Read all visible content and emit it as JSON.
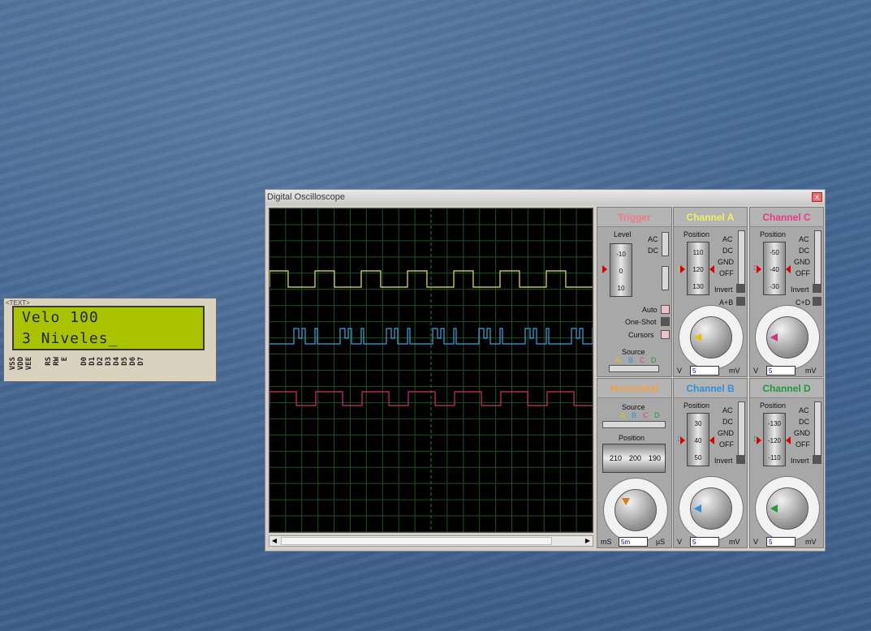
{
  "lcd": {
    "tag": "<TEXT>",
    "line1": "Velo 100",
    "line2": "3 Niveles_",
    "pins": [
      "VSS",
      "VDD",
      "VEE",
      "RS",
      "RW",
      "E",
      "D0",
      "D1",
      "D2",
      "D3",
      "D4",
      "D5",
      "D6",
      "D7"
    ]
  },
  "scope": {
    "title": "Digital Oscilloscope",
    "close_label": "x",
    "traces": [
      {
        "name": "A",
        "color": "#e8e56a"
      },
      {
        "name": "B",
        "color": "#35a8e0"
      },
      {
        "name": "C",
        "color": "#d0306a"
      }
    ]
  },
  "trigger": {
    "title": "Trigger",
    "level_label": "Level",
    "drum": [
      "-10",
      "0",
      "10"
    ],
    "ac": "AC",
    "dc": "DC",
    "auto": "Auto",
    "one_shot": "One-Shot",
    "cursors": "Cursors",
    "source_label": "Source",
    "sources": [
      "A",
      "B",
      "C",
      "D"
    ],
    "title_color": "#f07a8a"
  },
  "horizontal": {
    "title": "Horizontal",
    "source_label": "Source",
    "sources": [
      "A",
      "B",
      "C",
      "D"
    ],
    "position_label": "Position",
    "position_values": [
      "210",
      "200",
      "190"
    ],
    "unit_left": "mS",
    "value": "5m",
    "unit_right": "µS",
    "scale": [
      "0.5",
      "0.2",
      "1",
      "2",
      "5",
      "10",
      "20",
      "50",
      "100",
      "200",
      "0.1",
      "50",
      "20",
      "10"
    ],
    "title_color": "#f0a040"
  },
  "channel_a": {
    "title": "Channel A",
    "position_label": "Position",
    "drum": [
      "110",
      "120",
      "130"
    ],
    "modes": [
      "AC",
      "DC",
      "GND",
      "OFF"
    ],
    "invert": "Invert",
    "extra": "A+B",
    "unit_left": "V",
    "value": "5",
    "unit_right": "mV",
    "title_color": "#f0f060"
  },
  "channel_b": {
    "title": "Channel B",
    "position_label": "Position",
    "drum": [
      "30",
      "40",
      "50"
    ],
    "modes": [
      "AC",
      "DC",
      "GND",
      "OFF"
    ],
    "invert": "Invert",
    "unit_left": "V",
    "value": "5",
    "unit_right": "mV",
    "title_color": "#2f8fd8"
  },
  "channel_c": {
    "title": "Channel C",
    "position_label": "Position",
    "drum": [
      "-50",
      "-40",
      "-30"
    ],
    "modes": [
      "AC",
      "DC",
      "GND",
      "OFF"
    ],
    "invert": "Invert",
    "extra": "C+D",
    "unit_left": "V",
    "value": "5",
    "unit_right": "mV",
    "title_color": "#e83a8a"
  },
  "channel_d": {
    "title": "Channel D",
    "position_label": "Position",
    "drum": [
      "-130",
      "-120",
      "-110"
    ],
    "modes": [
      "AC",
      "DC",
      "GND",
      "OFF"
    ],
    "invert": "Invert",
    "unit_left": "V",
    "value": "5",
    "unit_right": "mV",
    "title_color": "#1e9a3a"
  },
  "knob_scale": [
    "0.5",
    "0.2",
    "0.1",
    "1",
    "50",
    "2",
    "20",
    "5",
    "10",
    "10",
    "5",
    "20",
    "2"
  ]
}
